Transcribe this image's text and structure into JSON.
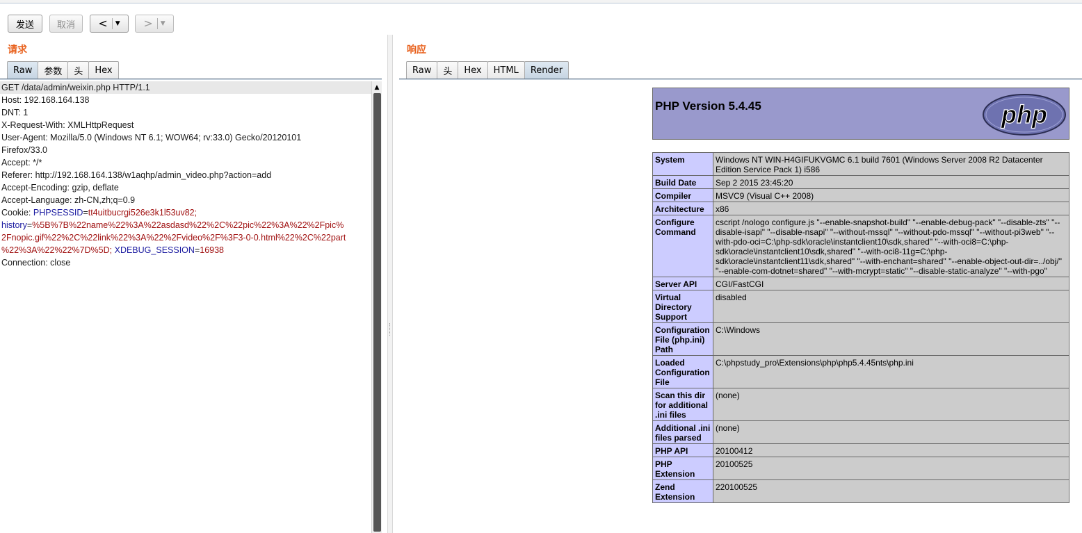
{
  "toolbar": {
    "send_label": "发送",
    "cancel_label": "取消",
    "back_arrow": "<",
    "forward_arrow": ">",
    "dropdown_glyph": "▼"
  },
  "request": {
    "title": "请求",
    "tabs": [
      "Raw",
      "参数",
      "头",
      "Hex"
    ],
    "active_tab": "Raw",
    "lines": [
      "GET /data/admin/weixin.php HTTP/1.1",
      "Host: 192.168.164.138",
      "DNT: 1",
      "X-Request-With: XMLHttpRequest",
      "User-Agent: Mozilla/5.0 (Windows NT 6.1; WOW64; rv:33.0) Gecko/20120101",
      "Firefox/33.0",
      "Accept: */*",
      "Referer: http://192.168.164.138/w1aqhp/admin_video.php?action=add",
      "Accept-Encoding: gzip, deflate",
      "Accept-Language: zh-CN,zh;q=0.9"
    ],
    "cookie": {
      "label": "Cookie: ",
      "phpsessid_name": "PHPSESSID",
      "phpsessid_value": "tt4uitbucrgi526e3k1l53uv82;",
      "history_name": "history",
      "history_value_1": "%5B%7B%22name%22%3A%22asdasd%22%2C%22pic%22%3A%22%2Fpic%",
      "history_value_2": "2Fnopic.gif%22%2C%22link%22%3A%22%2Fvideo%2F%3F3-0-0.html%22%2C%22part",
      "history_value_3": "%22%3A%22%22%7D%5D;",
      "xdebug_name": "XDEBUG_SESSION",
      "xdebug_value": "16938"
    },
    "last_line": "Connection: close"
  },
  "response": {
    "title": "响应",
    "tabs": [
      "Raw",
      "头",
      "Hex",
      "HTML",
      "Render"
    ],
    "active_tab": "Render",
    "php_version_title": "PHP Version 5.4.45",
    "logo_text": "php",
    "rows": [
      {
        "key": "System",
        "value": "Windows NT WIN-H4GIFUKVGMC 6.1 build 7601 (Windows Server 2008 R2 Datacenter Edition Service Pack 1) i586"
      },
      {
        "key": "Build Date",
        "value": "Sep 2 2015 23:45:20"
      },
      {
        "key": "Compiler",
        "value": "MSVC9 (Visual C++ 2008)"
      },
      {
        "key": "Architecture",
        "value": "x86"
      },
      {
        "key": "Configure Command",
        "value": "cscript /nologo configure.js \"--enable-snapshot-build\" \"--enable-debug-pack\" \"--disable-zts\" \"--disable-isapi\" \"--disable-nsapi\" \"--without-mssql\" \"--without-pdo-mssql\" \"--without-pi3web\" \"--with-pdo-oci=C:\\php-sdk\\oracle\\instantclient10\\sdk,shared\" \"--with-oci8=C:\\php-sdk\\oracle\\instantclient10\\sdk,shared\" \"--with-oci8-11g=C:\\php-sdk\\oracle\\instantclient11\\sdk,shared\" \"--with-enchant=shared\" \"--enable-object-out-dir=../obj/\" \"--enable-com-dotnet=shared\" \"--with-mcrypt=static\" \"--disable-static-analyze\" \"--with-pgo\""
      },
      {
        "key": "Server API",
        "value": "CGI/FastCGI"
      },
      {
        "key": "Virtual Directory Support",
        "value": "disabled"
      },
      {
        "key": "Configuration File (php.ini) Path",
        "value": "C:\\Windows"
      },
      {
        "key": "Loaded Configuration File",
        "value": "C:\\phpstudy_pro\\Extensions\\php\\php5.4.45nts\\php.ini"
      },
      {
        "key": "Scan this dir for additional .ini files",
        "value": "(none)"
      },
      {
        "key": "Additional .ini files parsed",
        "value": "(none)"
      },
      {
        "key": "PHP API",
        "value": "20100412"
      },
      {
        "key": "PHP Extension",
        "value": "20100525"
      },
      {
        "key": "Zend Extension",
        "value": "220100525"
      }
    ]
  }
}
